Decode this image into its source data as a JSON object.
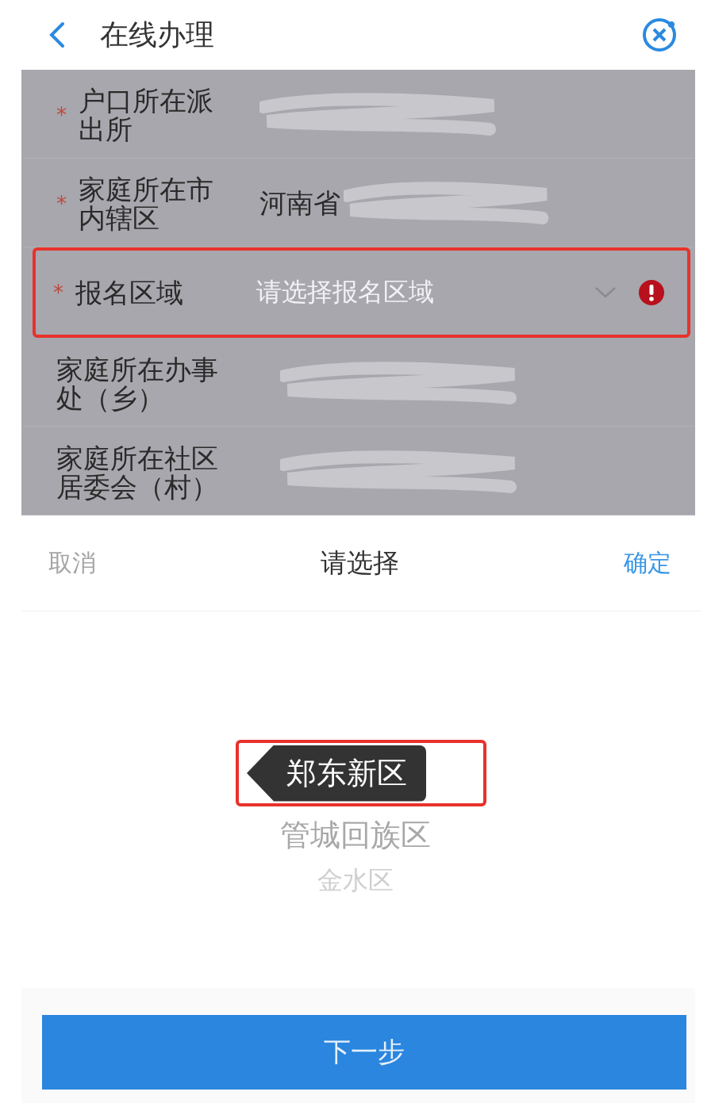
{
  "header": {
    "title": "在线办理"
  },
  "form": {
    "rows": [
      {
        "label": "户口所在派出所",
        "required_mark": "*",
        "redacted": true,
        "highlighted": false,
        "dropdown": false,
        "error": false
      },
      {
        "label": "家庭所在市内辖区",
        "required_mark": "*",
        "value": "河南省",
        "redacted": true,
        "highlighted": false,
        "dropdown": false,
        "error": false
      },
      {
        "label": "报名区域",
        "required_mark": "*",
        "redacted": false,
        "highlighted": true,
        "placeholder": "请选择报名区域",
        "dropdown": true,
        "error": true
      },
      {
        "label": "家庭所在办事处（乡）",
        "redacted": true,
        "highlighted": false,
        "dropdown": false,
        "error": false
      },
      {
        "label": "家庭所在社区居委会（村）",
        "redacted": true,
        "highlighted": false,
        "dropdown": false,
        "error": false
      }
    ]
  },
  "picker": {
    "cancel": "取消",
    "title": "请选择",
    "confirm": "确定",
    "options": [
      {
        "label": "郑东新区",
        "selected": true
      },
      {
        "label": "管城回族区",
        "selected": false
      },
      {
        "label": "金水区",
        "selected": false
      }
    ]
  },
  "next_button": "下一步"
}
